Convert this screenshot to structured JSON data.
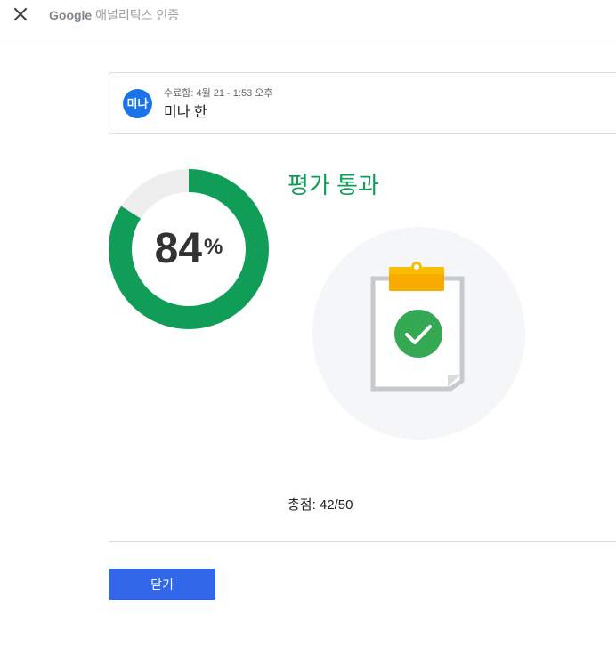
{
  "header": {
    "brand": "Google",
    "title_suffix": "애널리틱스 인증",
    "close_icon": "close-icon"
  },
  "submission": {
    "avatar_text": "미나",
    "avatar_color": "#1a73e8",
    "submitted_text": "수료함: 4월 21 - 1:53 오후",
    "user_name": "미나 한"
  },
  "result": {
    "score_percent": 84,
    "score_number": "84",
    "percent_sign": "%",
    "ring_color": "#0f9d58",
    "ring_track_color": "#eeeeee",
    "status_title": "평가 통과",
    "status_color": "#0f9d58",
    "illustration_icon": "clipboard-check-icon",
    "total_score_text": "총점: 42/50"
  },
  "footer": {
    "close_label": "닫기",
    "button_color": "#3367ea"
  }
}
